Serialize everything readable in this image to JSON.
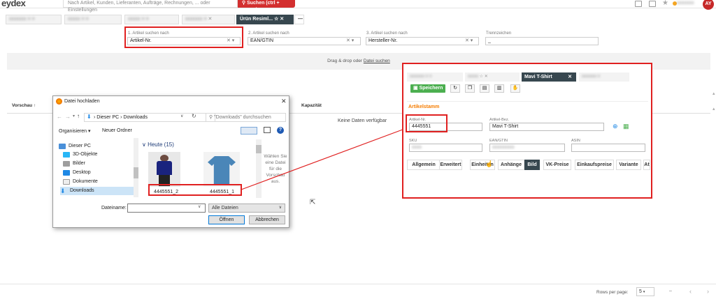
{
  "header": {
    "logo": "eydex",
    "search_placeholder": "Nach Artikel, Kunden, Lieferanten, Aufträge, Rechnungen, ... oder Einstellungen",
    "search_button": "Suchen (ctrl + space)",
    "avatar_initials": "AY"
  },
  "tabs": {
    "active_label": "Ürün Resiml...",
    "plus_label": "—"
  },
  "criteria": {
    "c1_label": "1. Artikel suchen nach",
    "c1_value": "Artikel-Nr.",
    "c2_label": "2. Artikel suchen nach",
    "c2_value": "EAN/GTIN",
    "c3_label": "3. Artikel suchen nach",
    "c3_value": "Hersteller-Nr.",
    "sep_label": "Trennzeichen",
    "sep_value": "_"
  },
  "dropzone": {
    "text": "Drag & drop oder",
    "link": "Datei suchen"
  },
  "table": {
    "col_preview": "Vorschau ↑",
    "col_capacity": "Kapazität",
    "no_data": "Keine Daten verfügbar"
  },
  "footer": {
    "rows_per_page_label": "Rows per page:",
    "rows_per_page_value": "5",
    "range": "–"
  },
  "dialog": {
    "title": "Datei hochladen",
    "path_pc": "Dieser PC",
    "path_downloads": "Downloads",
    "search_placeholder": "\"Downloads\" durchsuchen",
    "organize": "Organisieren ▾",
    "new_folder": "Neuer Ordner",
    "group_today": "Heute (15)",
    "tree": [
      "Dieser PC",
      "3D-Objekte",
      "Bilder",
      "Desktop",
      "Dokumente",
      "Downloads"
    ],
    "file1": "4445551_2",
    "file2": "4445551_1",
    "preview_hint": "Wählen Sie eine Datei für die Vorschau aus.",
    "filename_label": "Dateiname:",
    "filetype": "Alle Dateien",
    "open_button": "Öffnen",
    "cancel_button": "Abbrechen"
  },
  "article": {
    "tab_title": "Mavi T-Shirt",
    "save_button": "Speichern",
    "section_title": "Artikelstamm",
    "artnr_label": "Artikel-Nr.",
    "artnr_value": "4445551",
    "bez_label": "Artikel-Bez.",
    "bez_value": "Mavi T-Shirt",
    "sku_label": "SKU",
    "ean_label": "EAN/GTIN",
    "asin_label": "ASIN",
    "tabs": [
      "Allgemein",
      "Erweitert",
      "Einheiten",
      "Anhänge",
      "Bild",
      "VK-Preise",
      "Einkaufspreise",
      "Variante",
      "At"
    ],
    "active_tab": "Bild"
  },
  "colors": {
    "accent_red": "#d32f2f",
    "annotation_red": "#e02020",
    "tab_dark": "#37474f",
    "save_green": "#4caf50",
    "section_orange": "#f57c00"
  }
}
